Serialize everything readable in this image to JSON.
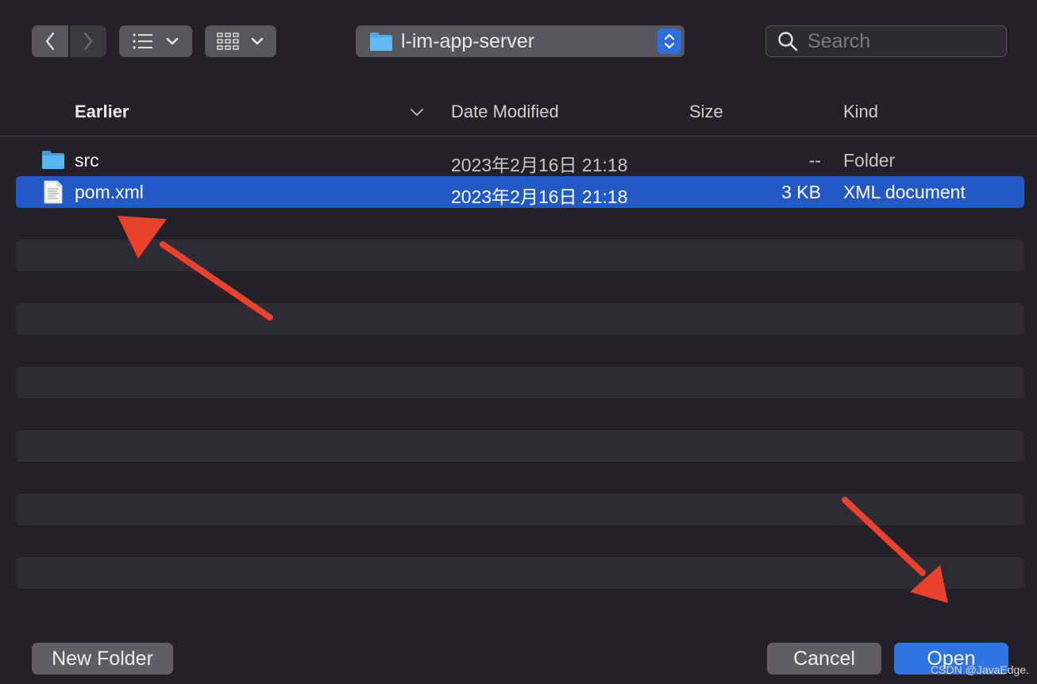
{
  "toolbar": {
    "back_icon": "chevron-left-icon",
    "forward_icon": "chevron-right-icon",
    "list_view_icon": "list-icon",
    "grid_view_icon": "grid-icon",
    "path_label": "l-im-app-server",
    "search_placeholder": "Search"
  },
  "columns": {
    "name": "Earlier",
    "date": "Date Modified",
    "size": "Size",
    "kind": "Kind"
  },
  "files": [
    {
      "name": "src",
      "date": "2023年2月16日 21:18",
      "size": "--",
      "kind": "Folder",
      "icon": "folder-icon",
      "selected": false
    },
    {
      "name": "pom.xml",
      "date": "2023年2月16日 21:18",
      "size": "3 KB",
      "kind": "XML document",
      "icon": "document-icon",
      "selected": true
    }
  ],
  "footer": {
    "new_folder_label": "New Folder",
    "cancel_label": "Cancel",
    "open_label": "Open"
  },
  "watermark": "CSDN @JavaEdge.",
  "colors": {
    "accent": "#2259c6",
    "annotation_arrow": "#e8412e",
    "background": "#232127"
  }
}
